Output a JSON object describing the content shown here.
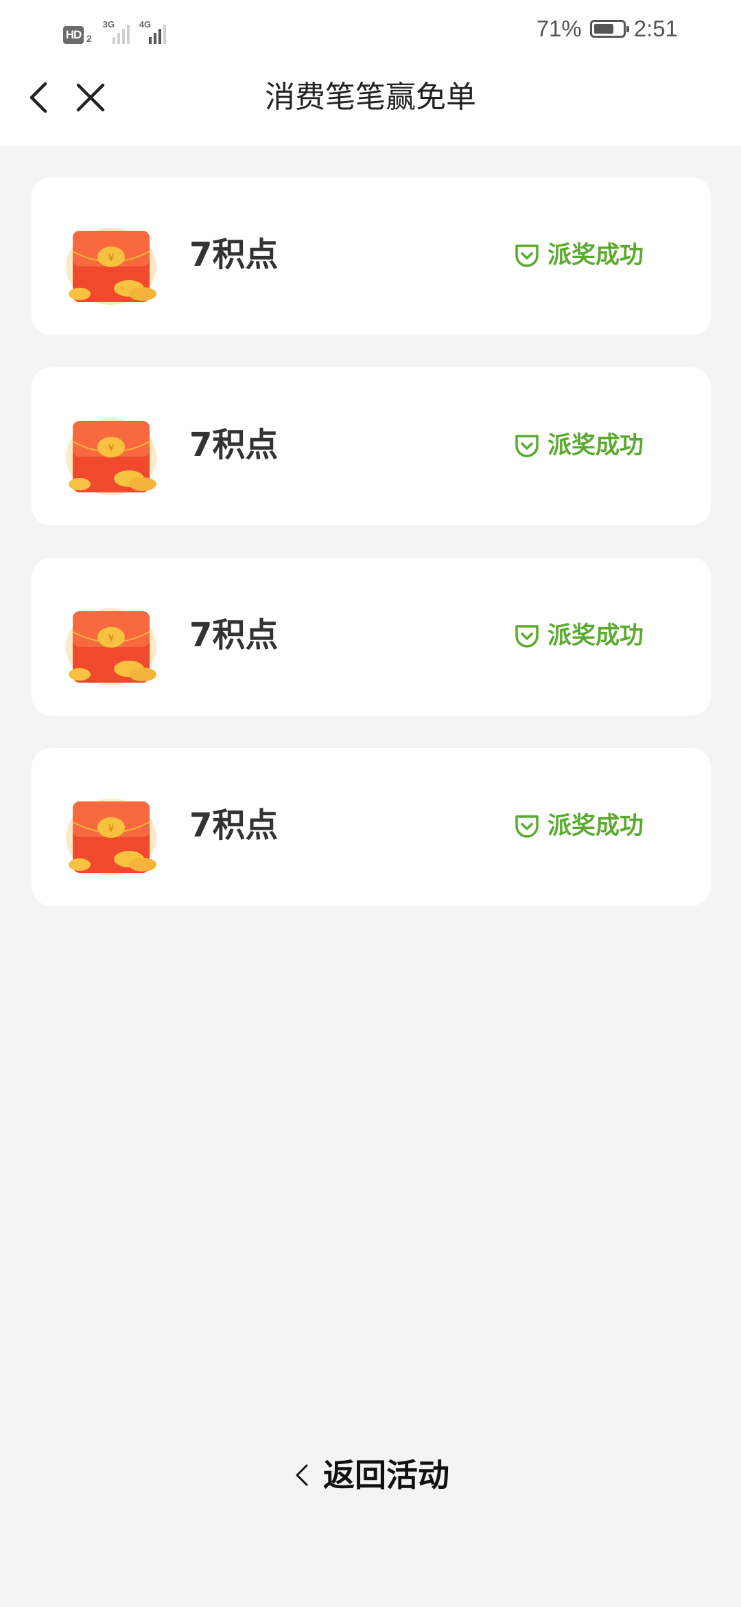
{
  "status_bar": {
    "hd_badge": "HD",
    "hd_sub": "2",
    "network_1": "3G",
    "network_2": "4G",
    "battery_percent_text": "71%",
    "battery_level": 0.71,
    "time": "2:51"
  },
  "nav": {
    "title": "消费笔笔赢免单",
    "back_icon": "chevron-left-icon",
    "close_icon": "close-icon"
  },
  "rewards": [
    {
      "amount": "7积点",
      "status": "派奖成功",
      "icon": "red-envelope-icon"
    },
    {
      "amount": "7积点",
      "status": "派奖成功",
      "icon": "red-envelope-icon"
    },
    {
      "amount": "7积点",
      "status": "派奖成功",
      "icon": "red-envelope-icon"
    },
    {
      "amount": "7积点",
      "status": "派奖成功",
      "icon": "red-envelope-icon"
    }
  ],
  "footer": {
    "return_label": "返回活动"
  },
  "colors": {
    "accent_green": "#5aaa2e",
    "background": "#f4f4f4",
    "envelope_red": "#f0492d",
    "coin_gold": "#f7c23f"
  }
}
